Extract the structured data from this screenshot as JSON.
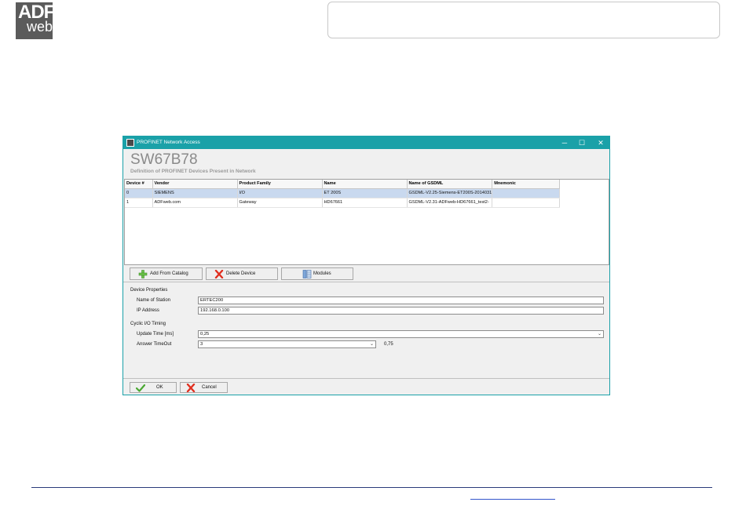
{
  "logo": {
    "line1": "ADF",
    "line2": "web"
  },
  "window": {
    "title": "PROFINET Network Access",
    "controls": {
      "minimize": "─",
      "maximize": "☐",
      "close": "✕"
    },
    "header_title": "SW67B78",
    "header_subtitle": "Definition of PROFINET Devices Present in Network"
  },
  "table": {
    "columns": [
      "Device #",
      "Vendor",
      "Product Family",
      "Name",
      "Name of GSDML",
      "Mnemonic"
    ],
    "rows": [
      [
        "0",
        "SIEMENS",
        "I/O",
        "ET 200S",
        "GSDML-V2.25-Siemens-ET200S-2014031",
        ""
      ],
      [
        "1",
        "ADFweb.com",
        "Gateway",
        "HD67661",
        "GSDML-V2.31-ADFweb-HD67661_test2-",
        ""
      ]
    ]
  },
  "toolbar": {
    "add_label": "Add From Catalog",
    "delete_label": "Delete Device",
    "modules_label": "Modules"
  },
  "device_properties": {
    "section_label": "Device Properties",
    "station_label": "Name of Station",
    "station_value": "ERTEC200",
    "ip_label": "IP Address",
    "ip_value": "192.168.0.100"
  },
  "cyclic_timing": {
    "section_label": "Cyclic I/O Timing",
    "update_label": "Update Time [ms]",
    "update_value": "0,25",
    "timeout_label": "Answer TimeOut",
    "timeout_value": "3",
    "timeout_result": "0,75"
  },
  "footer": {
    "ok_label": "OK",
    "cancel_label": "Cancel"
  },
  "colors": {
    "titlebar": "#1aa1a8",
    "selection": "#c9d9ef"
  }
}
